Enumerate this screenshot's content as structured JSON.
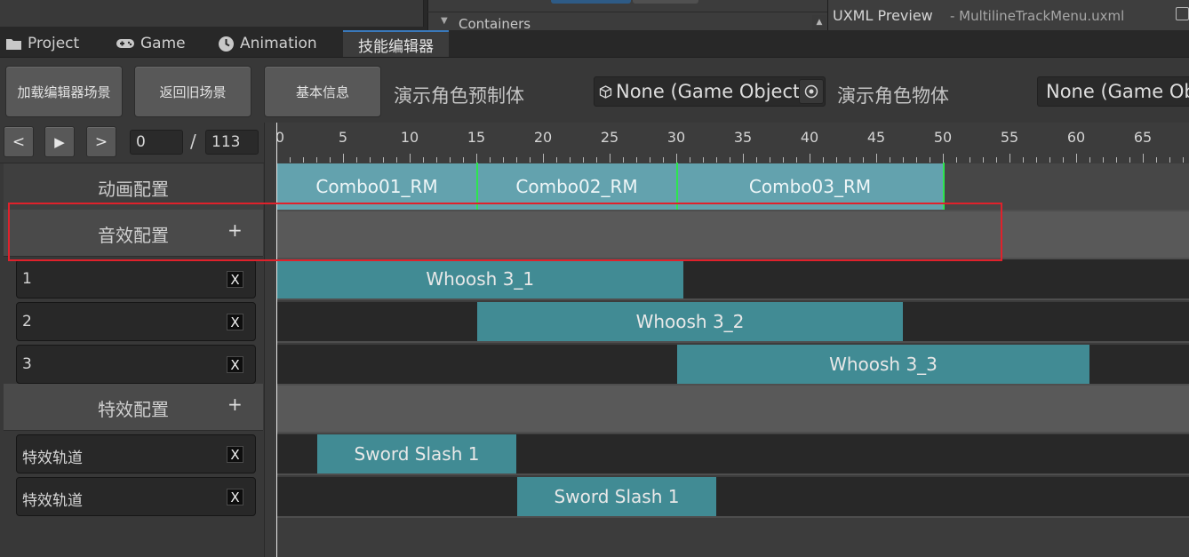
{
  "top": {
    "containers_label": "Containers",
    "uxml_title": "UXML Preview",
    "uxml_file": "- MultilineTrackMenu.uxml"
  },
  "tabs": [
    {
      "label": "Project",
      "icon": "folder-icon"
    },
    {
      "label": "Game",
      "icon": "gamepad-icon"
    },
    {
      "label": "Animation",
      "icon": "clock-icon"
    },
    {
      "label": "技能编辑器",
      "active": true
    }
  ],
  "toolbar": {
    "load_scene": "加载编辑器场景",
    "return_scene": "返回旧场景",
    "basic_info": "基本信息",
    "prefab_label": "演示角色预制体",
    "prefab_value": "None (Game Object)",
    "object_label": "演示角色物体",
    "object_value": "None (Game Object)"
  },
  "controls": {
    "prev": "<",
    "play": "▶",
    "next": ">",
    "current_frame": "0",
    "separator": "/",
    "total_frames": "113"
  },
  "ruler": {
    "labels": [
      "0",
      "5",
      "10",
      "15",
      "20",
      "25",
      "30",
      "35",
      "40",
      "45",
      "50",
      "55",
      "60",
      "65"
    ],
    "frames_visible": 68
  },
  "groups": {
    "animation": {
      "title": "动画配置"
    },
    "audio": {
      "title": "音效配置",
      "add": "+"
    },
    "effects": {
      "title": "特效配置",
      "add": "+"
    }
  },
  "audio_tracks": [
    {
      "name": "1",
      "remove": "X"
    },
    {
      "name": "2",
      "remove": "X"
    },
    {
      "name": "3",
      "remove": "X"
    }
  ],
  "effect_tracks": [
    {
      "name": "特效轨道",
      "remove": "X"
    },
    {
      "name": "特效轨道",
      "remove": "X"
    }
  ],
  "clips": {
    "animation": [
      {
        "label": "Combo01_RM",
        "start": 0,
        "end": 15
      },
      {
        "label": "Combo02_RM",
        "start": 15,
        "end": 30
      },
      {
        "label": "Combo03_RM",
        "start": 30,
        "end": 50
      }
    ],
    "audio": [
      {
        "label": "Whoosh 3_1",
        "start": 0,
        "end": 30.5
      },
      {
        "label": "Whoosh 3_2",
        "start": 15,
        "end": 47
      },
      {
        "label": "Whoosh 3_3",
        "start": 30,
        "end": 61
      }
    ],
    "effects": [
      {
        "label": "Sword Slash 1",
        "start": 3,
        "end": 18
      },
      {
        "label": "Sword Slash 1",
        "start": 18,
        "end": 33
      }
    ]
  },
  "colors": {
    "animation_clip": "#63a2ae",
    "track_clip": "#418b94",
    "clip_boundary": "#2ee54f",
    "highlight": "#e0212b",
    "active_tab_accent": "#3a79bb"
  }
}
